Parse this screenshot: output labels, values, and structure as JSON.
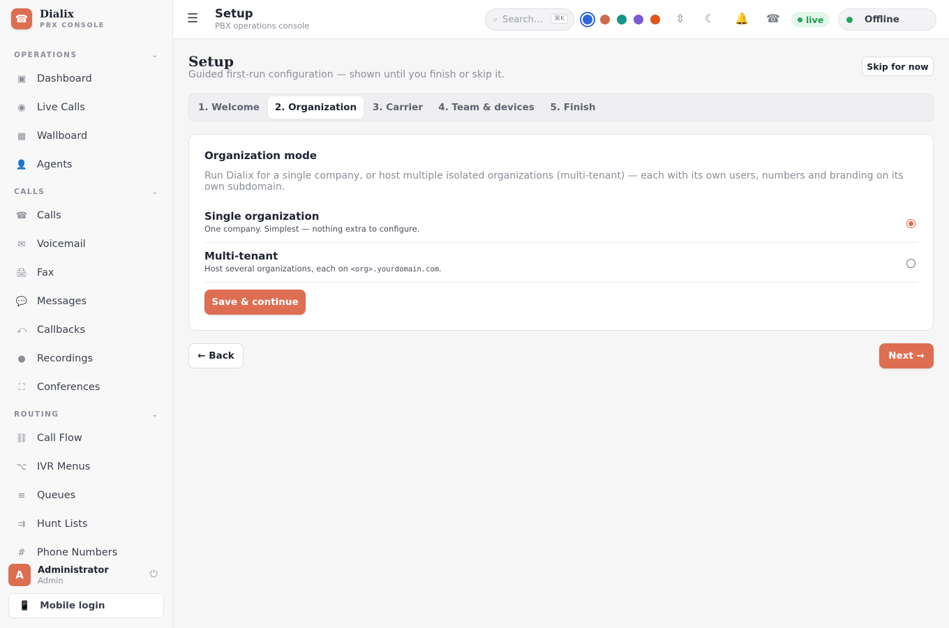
{
  "brand": {
    "name": "Dialix",
    "subtitle": "PBX CONSOLE",
    "logo_icon": "☎"
  },
  "sidebar": {
    "sections": [
      {
        "label": "OPERATIONS",
        "chevron": "⌄"
      },
      {
        "label": "CALLS",
        "chevron": "⌄"
      },
      {
        "label": "ROUTING",
        "chevron": "⌄"
      }
    ],
    "items": [
      {
        "label": "Dashboard",
        "icon": "▣"
      },
      {
        "label": "Live Calls",
        "icon": "◉"
      },
      {
        "label": "Wallboard",
        "icon": "▦"
      },
      {
        "label": "Agents",
        "icon": "👤"
      },
      {
        "label": "Calls",
        "icon": "☎"
      },
      {
        "label": "Voicemail",
        "icon": "✉"
      },
      {
        "label": "Fax",
        "icon": "🖨"
      },
      {
        "label": "Messages",
        "icon": "💬"
      },
      {
        "label": "Callbacks",
        "icon": "⤺"
      },
      {
        "label": "Recordings",
        "icon": "●"
      },
      {
        "label": "Conferences",
        "icon": "⛶"
      },
      {
        "label": "Call Flow",
        "icon": "⛓"
      },
      {
        "label": "IVR Menus",
        "icon": "⌥"
      },
      {
        "label": "Queues",
        "icon": "≡"
      },
      {
        "label": "Hunt Lists",
        "icon": "⇉"
      },
      {
        "label": "Phone Numbers",
        "icon": "#"
      }
    ],
    "user": {
      "initial": "A",
      "name": "Administrator",
      "role": "Admin",
      "logout_icon": "⏻"
    },
    "mobile_login": {
      "label": "Mobile login",
      "icon": "📱"
    }
  },
  "topbar": {
    "menu_icon": "☰",
    "title": "Setup",
    "subtitle": "PBX operations console",
    "search": {
      "placeholder": "Search…",
      "shortcut": "⌘K",
      "icon": "⌕"
    },
    "theme_colors": [
      "#2f66d8",
      "#cf6a4c",
      "#179488",
      "#7b5ad6",
      "#e0561e"
    ],
    "icons": {
      "density": "⇳",
      "dark_mode": "☾",
      "notifications": "🔔",
      "phone": "☎"
    },
    "live_badge": "live",
    "status": "Offline"
  },
  "page": {
    "title": "Setup",
    "subtitle": "Guided first-run configuration — shown until you finish or skip it.",
    "skip_label": "Skip for now",
    "tabs": [
      "1. Welcome",
      "2. Organization",
      "3. Carrier",
      "4. Team & devices",
      "5. Finish"
    ],
    "active_tab": 1,
    "card": {
      "title": "Organization mode",
      "description": "Run Dialix for a single company, or host multiple isolated organizations (multi-tenant) — each with its own users, numbers and branding on its own subdomain.",
      "options": [
        {
          "title": "Single organization",
          "desc": "One company. Simplest — nothing extra to configure.",
          "checked": true
        },
        {
          "title": "Multi-tenant",
          "desc_prefix": "Host several organizations, each on ",
          "desc_code": "<org>.yourdomain.com",
          "desc_suffix": ".",
          "checked": false
        }
      ],
      "save_label": "Save & continue"
    },
    "back_label": "← Back",
    "next_label": "Next →"
  }
}
